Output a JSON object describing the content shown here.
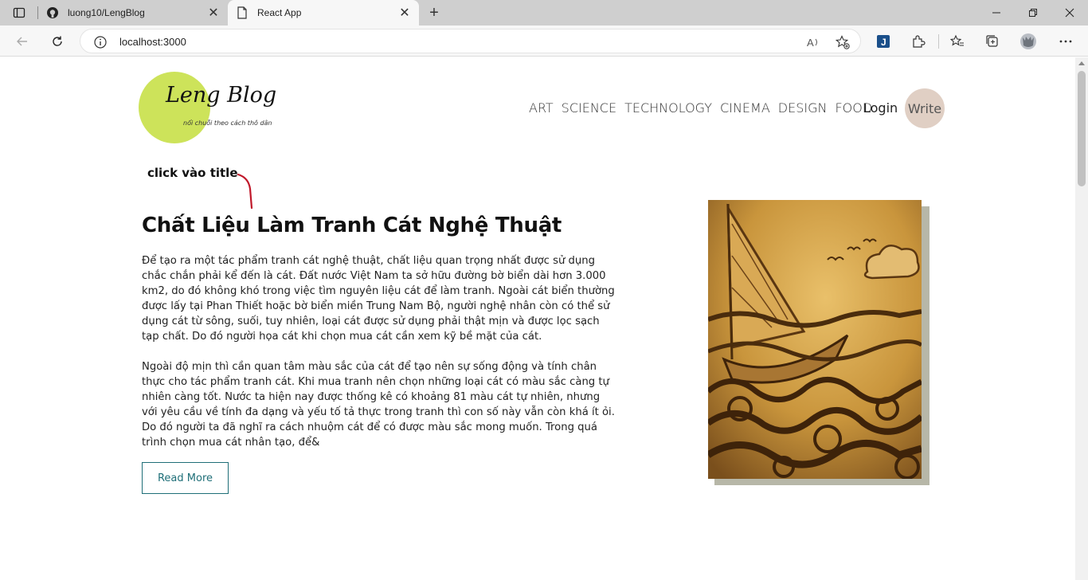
{
  "browser": {
    "tabs": [
      {
        "title": "luong10/LengBlog",
        "icon": "github-icon"
      },
      {
        "title": "React App",
        "icon": "document-icon"
      }
    ],
    "address": "localhost:3000"
  },
  "site": {
    "logo": {
      "title": "Leng Blog",
      "tagline": "nối chuỗi theo cách thô dân"
    },
    "nav": [
      "ART",
      "SCIENCE",
      "TECHNOLOGY",
      "CINEMA",
      "DESIGN",
      "FOOD"
    ],
    "login": "Login",
    "write": "Write"
  },
  "annotation": "click vào title",
  "post": {
    "title": "Chất Liệu Làm Tranh Cát Nghệ Thuật",
    "paragraphs": [
      "Để tạo ra một tác phẩm tranh cát nghệ thuật, chất liệu quan trọng nhất được sử dụng chắc chắn phải kể đến là cát. Đất nước Việt Nam ta sở hữu đường bờ biển dài hơn 3.000 km2, do đó không khó trong việc tìm nguyên liệu cát để làm tranh. Ngoài cát biển thường được lấy tại Phan Thiết hoặc bờ biển miền Trung Nam Bộ, người nghệ nhân còn có thể sử dụng cát từ sông, suối, tuy nhiên, loại cát được sử dụng phải thật mịn và được lọc sạch tạp chất. Do đó người họa cát khi chọn mua cát cần xem kỹ bề mặt của cát.",
      "Ngoài độ mịn thì cần quan tâm màu sắc của cát để tạo nên sự sống động và tính chân thực cho tác phẩm tranh cát. Khi mua tranh nên chọn những loại cát có màu sắc càng tự nhiên càng tốt. Nước ta hiện nay được thống kê có khoảng 81 màu cát tự nhiên, nhưng với yêu cầu về tính đa dạng và yếu tố tả thực trong tranh thì con số này vẫn còn khá ít ỏi. Do đó người ta đã nghĩ ra cách nhuộm cát để có được màu sắc mong muốn. Trong quá trình chọn mua cát nhân tạo, để&"
    ],
    "read_more": "Read More"
  },
  "colors": {
    "logo_circle": "#cde35a",
    "write_bg": "#e0cfc4",
    "read_more": "#1f6f78",
    "image_shadow": "#b7b7a8"
  }
}
